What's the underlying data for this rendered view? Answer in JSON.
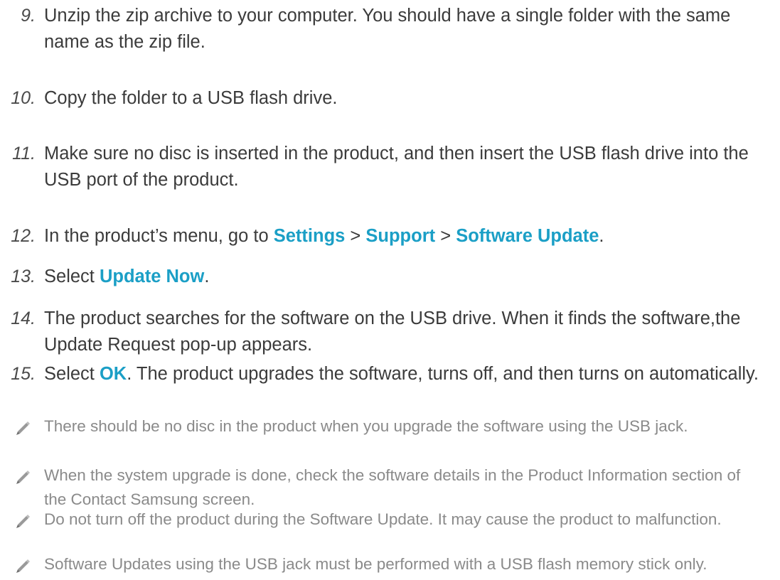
{
  "steps": [
    {
      "num": "9.",
      "parts": [
        {
          "t": "Unzip the zip archive to your computer. You should have a single folder with the same name as the zip file."
        }
      ]
    },
    {
      "num": "10.",
      "parts": [
        {
          "t": "Copy the folder to a USB flash drive."
        }
      ]
    },
    {
      "num": "11.",
      "parts": [
        {
          "t": "Make sure no disc is inserted in the product, and then insert the USB flash drive into the USB port of the product."
        }
      ]
    },
    {
      "num": "12.",
      "parts": [
        {
          "t": "In the product’s menu, go to "
        },
        {
          "t": "Settings",
          "hl": true
        },
        {
          "t": " > "
        },
        {
          "t": "Support",
          "hl": true
        },
        {
          "t": " > "
        },
        {
          "t": "Software Update",
          "hl": true
        },
        {
          "t": "."
        }
      ]
    },
    {
      "num": "13.",
      "parts": [
        {
          "t": "Select "
        },
        {
          "t": "Update Now",
          "hl": true
        },
        {
          "t": "."
        }
      ]
    },
    {
      "num": "14.",
      "parts": [
        {
          "t": "The product searches for the software on the USB drive. When it finds the software,the Update Request pop-up appears."
        }
      ]
    },
    {
      "num": "15.",
      "parts": [
        {
          "t": "Select "
        },
        {
          "t": "OK",
          "hl": true
        },
        {
          "t": ". The product upgrades the software, turns off, and then turns on automatically."
        }
      ]
    }
  ],
  "notes": [
    {
      "icon": "pencil-icon",
      "text": "There should be no disc in the product when you upgrade the software using the USB jack."
    },
    {
      "icon": "pencil-icon",
      "text": "When the system upgrade is done, check the software details in the Product Information section of the Contact Samsung screen."
    },
    {
      "icon": "pencil-icon",
      "text": "Do not turn off the product during the Software Update. It may cause the product to malfunction."
    },
    {
      "icon": "pencil-icon",
      "text": "Software Updates using the USB jack must be performed with a USB flash memory stick only."
    }
  ],
  "colors": {
    "highlight": "#1b9fc6",
    "body_text": "#3b3b3b",
    "note_text": "#8a8a8a"
  }
}
